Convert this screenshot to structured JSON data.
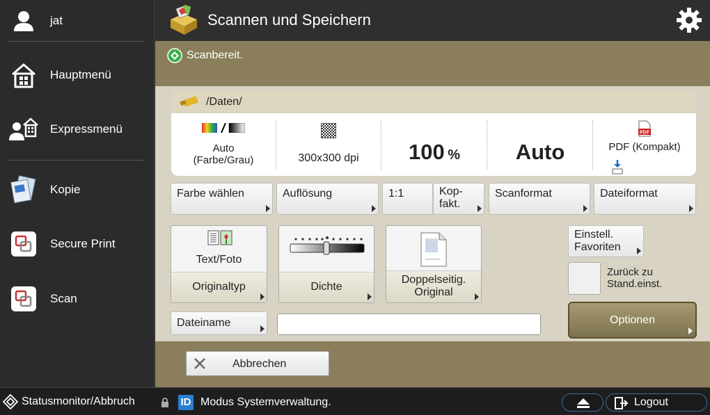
{
  "sidebar": {
    "user": "jat",
    "items": [
      {
        "label": "Hauptmenü"
      },
      {
        "label": "Expressmenü"
      },
      {
        "label": "Kopie"
      },
      {
        "label": "Secure Print"
      },
      {
        "label": "Scan"
      }
    ]
  },
  "header": {
    "title": "Scannen und Speichern"
  },
  "status": {
    "text": "Scanbereit."
  },
  "panel": {
    "path": "/Daten/",
    "color_value": "Auto\n(Farbe/Grau)",
    "resolution_value": "300x300 dpi",
    "ratio_value": "100",
    "ratio_unit": "%",
    "scanformat_value": "Auto",
    "fileformat_value": "PDF (Kompakt)"
  },
  "setting_buttons": {
    "color": "Farbe wählen",
    "resolution": "Auflösung",
    "ratio": "1:1",
    "copyfactor": "Kop-\nfakt.",
    "scanformat": "Scanformat",
    "fileformat": "Dateiformat"
  },
  "function_buttons": {
    "originaltype_value": "Text/Foto",
    "originaltype_label": "Originaltyp",
    "density_label": "Dichte",
    "duplex_label": "Doppelseitig.\nOriginal",
    "favorites": "Einstell.\nFavoriten",
    "reset": "Zurück zu\nStand.einst.",
    "options": "Optionen",
    "filename": "Dateiname",
    "filename_value": ""
  },
  "actions": {
    "cancel": "Abbrechen"
  },
  "footer": {
    "status_monitor": "Statusmonitor/Abbruch",
    "mode": "Modus Systemverwaltung.",
    "logout": "Logout"
  },
  "colors": {
    "accent_olive": "#8a7f5a",
    "body": "#d8d3c3",
    "dark": "#2b2b2b",
    "ready_green": "#3dae4a"
  }
}
